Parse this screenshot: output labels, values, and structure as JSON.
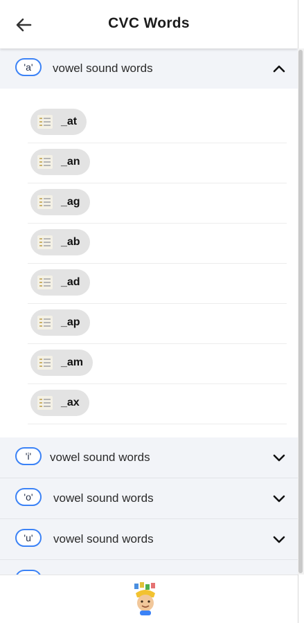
{
  "app": {
    "title": "CVC Words"
  },
  "icons": {
    "back": "arrow-left-icon",
    "expanded": "chevron-up-icon",
    "collapsed": "chevron-down-icon",
    "word": "document-list-icon",
    "mascot": "kid-mascot-icon"
  },
  "colors": {
    "accent": "#3b82f6",
    "header_bg": "#f2f4f8",
    "chip_bg": "#e3e3e3"
  },
  "sections": [
    {
      "vowel": "'a'",
      "label": "vowel sound words",
      "expanded": true,
      "words": [
        "_at",
        "_an",
        "_ag",
        "_ab",
        "_ad",
        "_ap",
        "_am",
        "_ax"
      ]
    },
    {
      "vowel": "'i'",
      "label": "vowel sound words",
      "expanded": false
    },
    {
      "vowel": "'o'",
      "label": "vowel sound words",
      "expanded": false
    },
    {
      "vowel": "'u'",
      "label": "vowel sound words",
      "expanded": false
    }
  ]
}
